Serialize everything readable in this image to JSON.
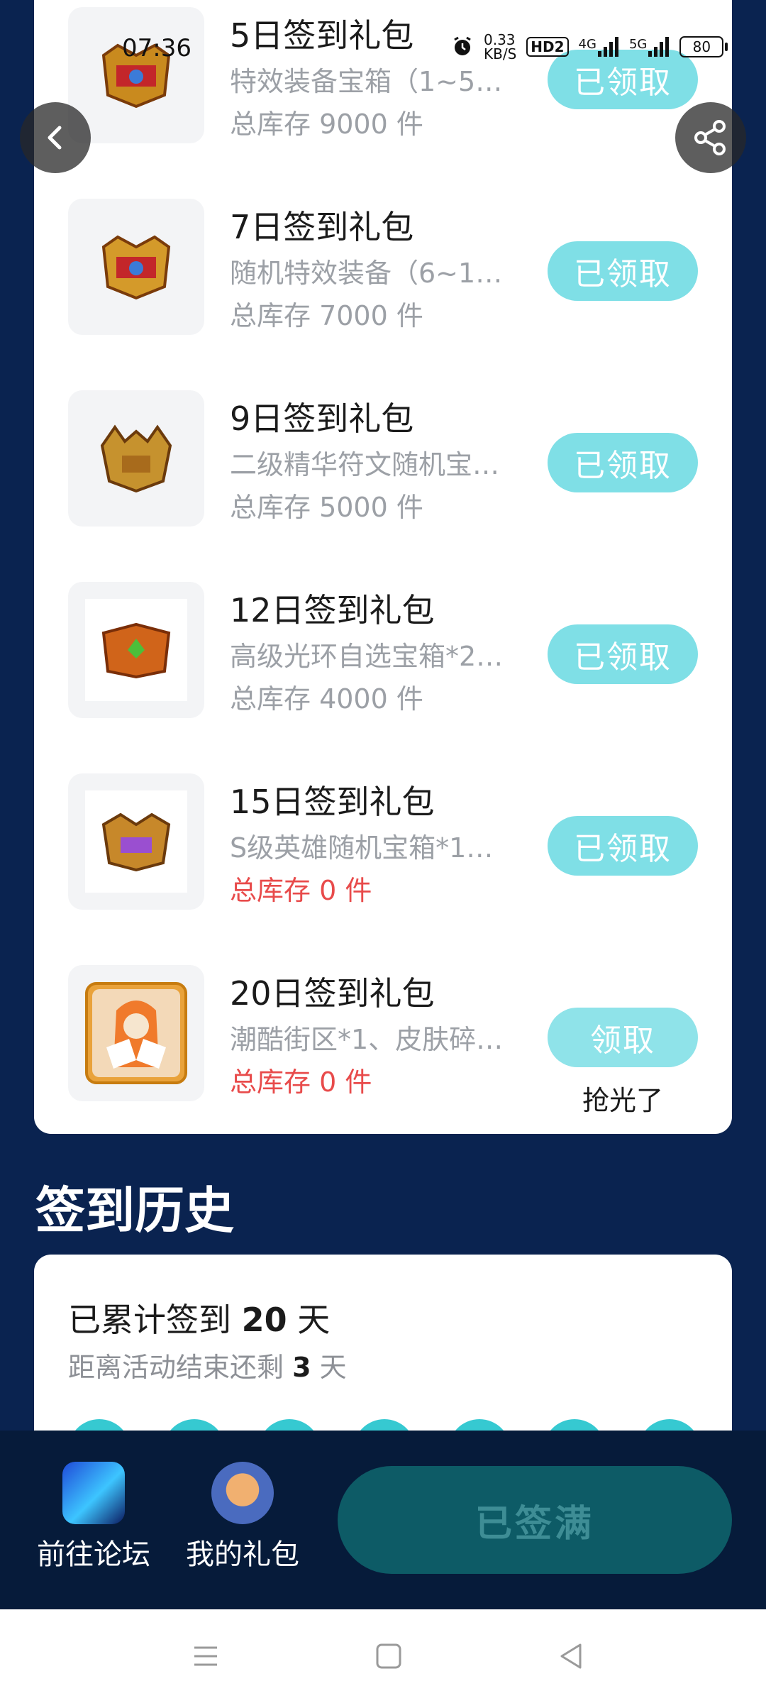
{
  "status_bar": {
    "time": "07:36",
    "net_speed_value": "0.33",
    "net_speed_unit": "KB/S",
    "hd": "HD2",
    "signal1": "4G",
    "signal2": "5G",
    "battery": "80"
  },
  "gifts": [
    {
      "title": "5日签到礼包",
      "desc": "特效装备宝箱（1~5…",
      "stock": "总库存 9000 件",
      "button": "已领取",
      "stock_zero": false
    },
    {
      "title": "7日签到礼包",
      "desc": "随机特效装备（6~1…",
      "stock": "总库存 7000 件",
      "button": "已领取",
      "stock_zero": false
    },
    {
      "title": "9日签到礼包",
      "desc": "二级精华符文随机宝…",
      "stock": "总库存 5000 件",
      "button": "已领取",
      "stock_zero": false
    },
    {
      "title": "12日签到礼包",
      "desc": "高级光环自选宝箱*2…",
      "stock": "总库存 4000 件",
      "button": "已领取",
      "stock_zero": false
    },
    {
      "title": "15日签到礼包",
      "desc": "S级英雄随机宝箱*1…",
      "stock": "总库存 0 件",
      "button": "已领取",
      "stock_zero": true
    },
    {
      "title": "20日签到礼包",
      "desc": "潮酷街区*1、皮肤碎…",
      "stock": "总库存 0 件",
      "button": "领取",
      "stock_zero": true,
      "note": "抢光了"
    }
  ],
  "history": {
    "title": "签到历史",
    "sum_prefix": "已累计签到",
    "sum_days": "20",
    "sum_suffix": "天",
    "remain_prefix": "距离活动结束还剩",
    "remain_days": "3",
    "remain_suffix": "天"
  },
  "bottom": {
    "forum_label": "前往论坛",
    "gifts_label": "我的礼包",
    "signed_label": "已签满"
  },
  "colors": {
    "page_bg": "#0a2350",
    "button_teal": "#7fdfe6",
    "stock_zero": "#e84b4b"
  }
}
